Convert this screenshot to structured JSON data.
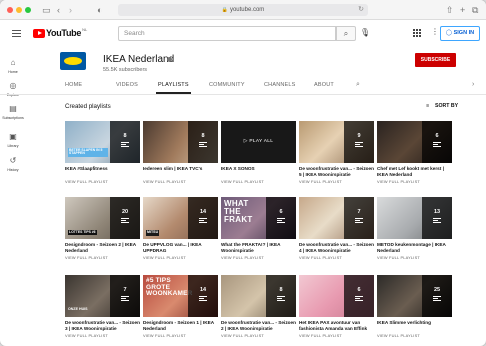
{
  "browser": {
    "url": "youtube.com",
    "colors": {
      "red": "#ff5f57",
      "yellow": "#febc2e",
      "green": "#28c840"
    }
  },
  "header": {
    "logo_text": "YouTube",
    "logo_region": "NL",
    "search_placeholder": "Search",
    "signin_label": "SIGN IN"
  },
  "sidebar": {
    "items": [
      {
        "label": "Home",
        "icon": "home-icon"
      },
      {
        "label": "Explore",
        "icon": "compass-icon"
      },
      {
        "label": "Subscriptions",
        "icon": "subscriptions-icon"
      },
      {
        "label": "Library",
        "icon": "library-icon"
      },
      {
        "label": "History",
        "icon": "history-icon"
      }
    ]
  },
  "channel": {
    "name": "IKEA Nederland",
    "subscribers": "55.5K subscribers",
    "subscribe_label": "SUBSCRIBE",
    "colors": {
      "subscribe_bg": "#cc0000",
      "logo_blue": "#0058a3",
      "logo_yellow": "#ffdb00"
    }
  },
  "tabs": [
    "HOME",
    "VIDEOS",
    "PLAYLISTS",
    "COMMUNITY",
    "CHANNELS",
    "ABOUT"
  ],
  "active_tab": "PLAYLISTS",
  "section": {
    "title": "Created playlists",
    "sort_label": "SORT BY"
  },
  "view_label": "VIEW FULL PLAYLIST",
  "playlists": [
    {
      "title": "IKEA #Slaapfitness",
      "count": "8",
      "thumb_text": "BETER SLAPEN IN 5 STAPPEN"
    },
    {
      "title": "Iedereen slim | IKEA TVC's",
      "count": "8"
    },
    {
      "title": "IKEA X SONOS",
      "count": "",
      "overlay_text": "PLAY ALL"
    },
    {
      "title": "De woonfrustratie van... - Seizoen 5 | IKEA Woonirspiratie",
      "count": "9"
    },
    {
      "title": "Chef met Lef kookt met kerst | IKEA Nederland",
      "count": "6"
    },
    {
      "title": "Designdroom - Seizoen 2 | IKEA Nederland",
      "count": "20",
      "thumb_text": "LOTTES TIPS #6"
    },
    {
      "title": "De UPPVLOG van... | IKEA UPPDRAG",
      "count": "14",
      "thumb_text": "MITSU"
    },
    {
      "title": "What the FRAKTA!? | IKEA Woonirspiratie",
      "count": "6",
      "thumb_text": "WHAT THE FRAKT"
    },
    {
      "title": "De woonfrustratie van... - Seizoen 4 | IKEA Woonirspiratie",
      "count": "7"
    },
    {
      "title": "METOD keukenmontage | IKEA Nederland",
      "count": "13"
    },
    {
      "title": "De woonfrustratie van... - Seizoen 3 | IKEA Woonirspiratie",
      "count": "7",
      "thumb_text": "ONZE HUIS"
    },
    {
      "title": "Designdroom - Seizoen 1 | IKEA Nederland",
      "count": "14",
      "thumb_text": "#5 TIPS GROTE WOONKAMER"
    },
    {
      "title": "De woonfrustratie van... - Seizoen 2 | IKEA Woonirspiratie",
      "count": "8"
    },
    {
      "title": "Het IKEA PAX avontuur van fashionista Amanda van Effink",
      "count": "6"
    },
    {
      "title": "IKEA Slimme verlichting",
      "count": "25"
    }
  ]
}
